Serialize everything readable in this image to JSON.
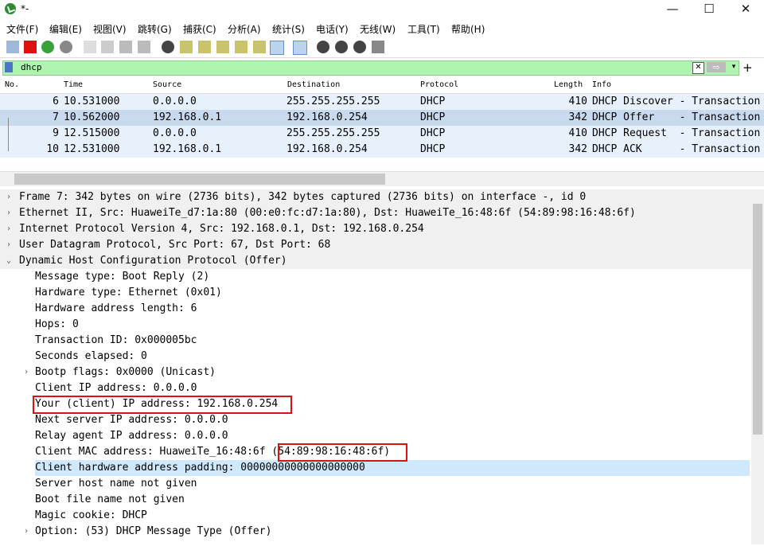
{
  "window": {
    "title": "*-",
    "minimize": "—",
    "maximize": "☐",
    "close": "✕"
  },
  "menu": [
    "文件(F)",
    "编辑(E)",
    "视图(V)",
    "跳转(G)",
    "捕获(C)",
    "分析(A)",
    "统计(S)",
    "电话(Y)",
    "无线(W)",
    "工具(T)",
    "帮助(H)"
  ],
  "filter": {
    "value": "dhcp",
    "clear": "✕",
    "apply": "⇨",
    "dropdown": "▾",
    "add": "+"
  },
  "columns": [
    "No.",
    "Time",
    "Source",
    "Destination",
    "Protocol",
    "Length",
    "Info"
  ],
  "packets": [
    {
      "no": "6",
      "time": "10.531000",
      "src": "0.0.0.0",
      "dst": "255.255.255.255",
      "proto": "DHCP",
      "len": "410",
      "info": "DHCP Discover - Transaction"
    },
    {
      "no": "7",
      "time": "10.562000",
      "src": "192.168.0.1",
      "dst": "192.168.0.254",
      "proto": "DHCP",
      "len": "342",
      "info": "DHCP Offer    - Transaction"
    },
    {
      "no": "9",
      "time": "12.515000",
      "src": "0.0.0.0",
      "dst": "255.255.255.255",
      "proto": "DHCP",
      "len": "410",
      "info": "DHCP Request  - Transaction"
    },
    {
      "no": "10",
      "time": "12.531000",
      "src": "192.168.0.1",
      "dst": "192.168.0.254",
      "proto": "DHCP",
      "len": "342",
      "info": "DHCP ACK      - Transaction"
    }
  ],
  "details": {
    "frame": "Frame 7: 342 bytes on wire (2736 bits), 342 bytes captured (2736 bits) on interface -, id 0",
    "ethernet": "Ethernet II, Src: HuaweiTe_d7:1a:80 (00:e0:fc:d7:1a:80), Dst: HuaweiTe_16:48:6f (54:89:98:16:48:6f)",
    "ip": "Internet Protocol Version 4, Src: 192.168.0.1, Dst: 192.168.0.254",
    "udp": "User Datagram Protocol, Src Port: 67, Dst Port: 68",
    "dhcp": "Dynamic Host Configuration Protocol (Offer)",
    "fields": [
      "Message type: Boot Reply (2)",
      "Hardware type: Ethernet (0x01)",
      "Hardware address length: 6",
      "Hops: 0",
      "Transaction ID: 0x000005bc",
      "Seconds elapsed: 0",
      "Bootp flags: 0x0000 (Unicast)",
      "Client IP address: 0.0.0.0",
      "Your (client) IP address: 192.168.0.254",
      "Next server IP address: 0.0.0.0",
      "Relay agent IP address: 0.0.0.0",
      "Client MAC address: HuaweiTe_16:48:6f (54:89:98:16:48:6f)",
      "Client hardware address padding: 00000000000000000000",
      "Server host name not given",
      "Boot file name not given",
      "Magic cookie: DHCP",
      "Option: (53) DHCP Message Type (Offer)"
    ]
  },
  "colors": {
    "row_bg": "#e7f1fb",
    "selected_bg": "#c9d9ee",
    "filter_bg": "#aff4b0",
    "highlight": "#cfe8fc",
    "annotation": "#dd1111"
  }
}
